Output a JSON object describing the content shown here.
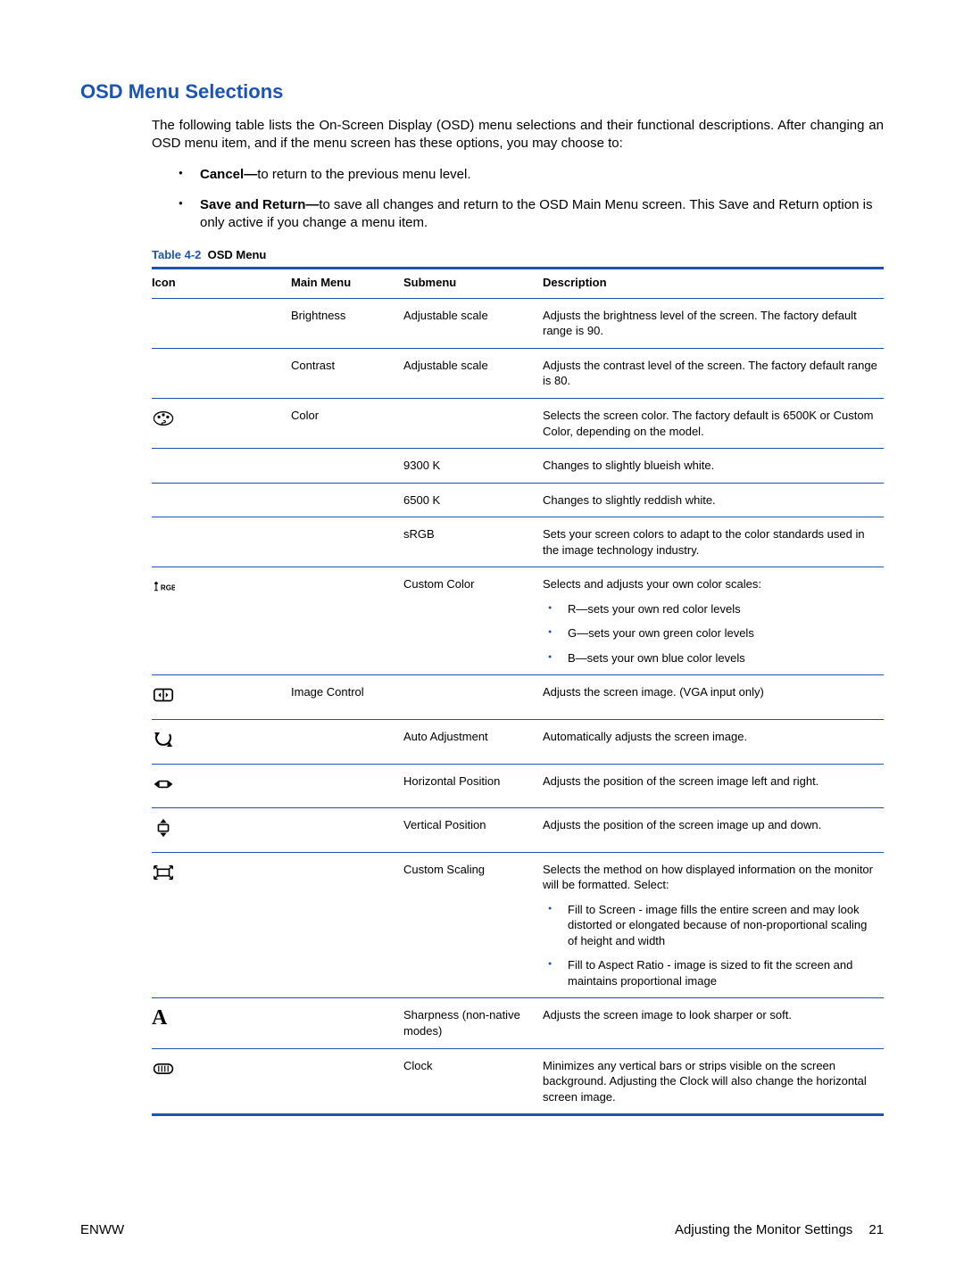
{
  "heading": "OSD Menu Selections",
  "intro": "The following table lists the On-Screen Display (OSD) menu selections and their functional descriptions. After changing an OSD menu item, and if the menu screen has these options, you may choose to:",
  "options": [
    {
      "lead": "Cancel—",
      "text": "to return to the previous menu level."
    },
    {
      "lead": "Save and Return—",
      "text": "to save all changes and return to the OSD Main Menu screen. This Save and Return option is only active if you change a menu item."
    }
  ],
  "table_caption_lead": "Table 4-2",
  "table_caption_title": "OSD Menu",
  "columns": {
    "icon": "Icon",
    "main": "Main Menu",
    "sub": "Submenu",
    "desc": "Description"
  },
  "rows": [
    {
      "icon": "",
      "main": "Brightness",
      "sub": "Adjustable scale",
      "desc": "Adjusts the brightness level of the screen. The factory default range is 90."
    },
    {
      "icon": "",
      "main": "Contrast",
      "sub": "Adjustable scale",
      "desc": "Adjusts the contrast level of the screen. The factory default range is 80."
    },
    {
      "icon": "color-palette-icon",
      "main": "Color",
      "sub": "",
      "desc": "Selects the screen color. The factory default is 6500K or Custom Color, depending on the model."
    },
    {
      "icon": "",
      "main": "",
      "sub": "9300 K",
      "desc": "Changes to slightly blueish white."
    },
    {
      "icon": "",
      "main": "",
      "sub": "6500 K",
      "desc": "Changes to slightly reddish white."
    },
    {
      "icon": "",
      "main": "",
      "sub": "sRGB",
      "desc": "Sets your screen colors to adapt to the color standards used in the image technology industry."
    },
    {
      "icon": "rgb-icon",
      "main": "",
      "sub": "Custom Color",
      "desc": "Selects and adjusts your own color scales:",
      "bullets": [
        "R—sets your own red color levels",
        "G—sets your own green color levels",
        "B—sets your own blue color levels"
      ]
    },
    {
      "icon": "image-control-icon",
      "main": "Image Control",
      "sub": "",
      "desc": "Adjusts the screen image. (VGA input only)"
    },
    {
      "icon": "auto-adjust-icon",
      "main": "",
      "sub": "Auto Adjustment",
      "desc": "Automatically adjusts the screen image."
    },
    {
      "icon": "horizontal-position-icon",
      "main": "",
      "sub": "Horizontal Position",
      "desc": "Adjusts the position of the screen image left and right."
    },
    {
      "icon": "vertical-position-icon",
      "main": "",
      "sub": "Vertical Position",
      "desc": "Adjusts the position of the screen image up and down."
    },
    {
      "icon": "custom-scaling-icon",
      "main": "",
      "sub": "Custom Scaling",
      "desc": "Selects the method on how displayed information on the monitor will be formatted. Select:",
      "bullets": [
        "Fill to Screen - image fills the entire screen and may look distorted or elongated because of non-proportional scaling of height and width",
        "Fill to Aspect Ratio - image is sized to fit the screen and maintains proportional image"
      ]
    },
    {
      "icon": "sharpness-icon",
      "main": "",
      "sub": "Sharpness (non-native modes)",
      "desc": "Adjusts the screen image to look sharper or soft."
    },
    {
      "icon": "clock-icon",
      "main": "",
      "sub": "Clock",
      "desc": "Minimizes any vertical bars or strips visible on the screen background. Adjusting the Clock will also change the horizontal screen image."
    }
  ],
  "footer": {
    "left": "ENWW",
    "right_text": "Adjusting the Monitor Settings",
    "page": "21"
  }
}
